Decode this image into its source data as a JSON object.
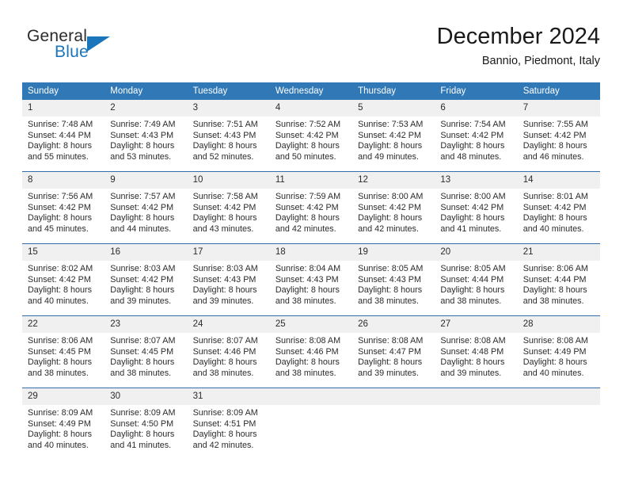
{
  "brand": {
    "name_part1": "General",
    "name_part2": "Blue",
    "logo_icon": "triangle-logo-icon",
    "accent_color": "#1b75bb"
  },
  "header": {
    "month_title": "December 2024",
    "location": "Bannio, Piedmont, Italy"
  },
  "calendar": {
    "header_bg_color": "#3178b6",
    "daynum_bg_color": "#f0f0f0",
    "weekdays": [
      "Sunday",
      "Monday",
      "Tuesday",
      "Wednesday",
      "Thursday",
      "Friday",
      "Saturday"
    ],
    "weeks": [
      [
        {
          "day": "1",
          "sunrise": "Sunrise: 7:48 AM",
          "sunset": "Sunset: 4:44 PM",
          "daylight_line1": "Daylight: 8 hours",
          "daylight_line2": "and 55 minutes."
        },
        {
          "day": "2",
          "sunrise": "Sunrise: 7:49 AM",
          "sunset": "Sunset: 4:43 PM",
          "daylight_line1": "Daylight: 8 hours",
          "daylight_line2": "and 53 minutes."
        },
        {
          "day": "3",
          "sunrise": "Sunrise: 7:51 AM",
          "sunset": "Sunset: 4:43 PM",
          "daylight_line1": "Daylight: 8 hours",
          "daylight_line2": "and 52 minutes."
        },
        {
          "day": "4",
          "sunrise": "Sunrise: 7:52 AM",
          "sunset": "Sunset: 4:42 PM",
          "daylight_line1": "Daylight: 8 hours",
          "daylight_line2": "and 50 minutes."
        },
        {
          "day": "5",
          "sunrise": "Sunrise: 7:53 AM",
          "sunset": "Sunset: 4:42 PM",
          "daylight_line1": "Daylight: 8 hours",
          "daylight_line2": "and 49 minutes."
        },
        {
          "day": "6",
          "sunrise": "Sunrise: 7:54 AM",
          "sunset": "Sunset: 4:42 PM",
          "daylight_line1": "Daylight: 8 hours",
          "daylight_line2": "and 48 minutes."
        },
        {
          "day": "7",
          "sunrise": "Sunrise: 7:55 AM",
          "sunset": "Sunset: 4:42 PM",
          "daylight_line1": "Daylight: 8 hours",
          "daylight_line2": "and 46 minutes."
        }
      ],
      [
        {
          "day": "8",
          "sunrise": "Sunrise: 7:56 AM",
          "sunset": "Sunset: 4:42 PM",
          "daylight_line1": "Daylight: 8 hours",
          "daylight_line2": "and 45 minutes."
        },
        {
          "day": "9",
          "sunrise": "Sunrise: 7:57 AM",
          "sunset": "Sunset: 4:42 PM",
          "daylight_line1": "Daylight: 8 hours",
          "daylight_line2": "and 44 minutes."
        },
        {
          "day": "10",
          "sunrise": "Sunrise: 7:58 AM",
          "sunset": "Sunset: 4:42 PM",
          "daylight_line1": "Daylight: 8 hours",
          "daylight_line2": "and 43 minutes."
        },
        {
          "day": "11",
          "sunrise": "Sunrise: 7:59 AM",
          "sunset": "Sunset: 4:42 PM",
          "daylight_line1": "Daylight: 8 hours",
          "daylight_line2": "and 42 minutes."
        },
        {
          "day": "12",
          "sunrise": "Sunrise: 8:00 AM",
          "sunset": "Sunset: 4:42 PM",
          "daylight_line1": "Daylight: 8 hours",
          "daylight_line2": "and 42 minutes."
        },
        {
          "day": "13",
          "sunrise": "Sunrise: 8:00 AM",
          "sunset": "Sunset: 4:42 PM",
          "daylight_line1": "Daylight: 8 hours",
          "daylight_line2": "and 41 minutes."
        },
        {
          "day": "14",
          "sunrise": "Sunrise: 8:01 AM",
          "sunset": "Sunset: 4:42 PM",
          "daylight_line1": "Daylight: 8 hours",
          "daylight_line2": "and 40 minutes."
        }
      ],
      [
        {
          "day": "15",
          "sunrise": "Sunrise: 8:02 AM",
          "sunset": "Sunset: 4:42 PM",
          "daylight_line1": "Daylight: 8 hours",
          "daylight_line2": "and 40 minutes."
        },
        {
          "day": "16",
          "sunrise": "Sunrise: 8:03 AM",
          "sunset": "Sunset: 4:42 PM",
          "daylight_line1": "Daylight: 8 hours",
          "daylight_line2": "and 39 minutes."
        },
        {
          "day": "17",
          "sunrise": "Sunrise: 8:03 AM",
          "sunset": "Sunset: 4:43 PM",
          "daylight_line1": "Daylight: 8 hours",
          "daylight_line2": "and 39 minutes."
        },
        {
          "day": "18",
          "sunrise": "Sunrise: 8:04 AM",
          "sunset": "Sunset: 4:43 PM",
          "daylight_line1": "Daylight: 8 hours",
          "daylight_line2": "and 38 minutes."
        },
        {
          "day": "19",
          "sunrise": "Sunrise: 8:05 AM",
          "sunset": "Sunset: 4:43 PM",
          "daylight_line1": "Daylight: 8 hours",
          "daylight_line2": "and 38 minutes."
        },
        {
          "day": "20",
          "sunrise": "Sunrise: 8:05 AM",
          "sunset": "Sunset: 4:44 PM",
          "daylight_line1": "Daylight: 8 hours",
          "daylight_line2": "and 38 minutes."
        },
        {
          "day": "21",
          "sunrise": "Sunrise: 8:06 AM",
          "sunset": "Sunset: 4:44 PM",
          "daylight_line1": "Daylight: 8 hours",
          "daylight_line2": "and 38 minutes."
        }
      ],
      [
        {
          "day": "22",
          "sunrise": "Sunrise: 8:06 AM",
          "sunset": "Sunset: 4:45 PM",
          "daylight_line1": "Daylight: 8 hours",
          "daylight_line2": "and 38 minutes."
        },
        {
          "day": "23",
          "sunrise": "Sunrise: 8:07 AM",
          "sunset": "Sunset: 4:45 PM",
          "daylight_line1": "Daylight: 8 hours",
          "daylight_line2": "and 38 minutes."
        },
        {
          "day": "24",
          "sunrise": "Sunrise: 8:07 AM",
          "sunset": "Sunset: 4:46 PM",
          "daylight_line1": "Daylight: 8 hours",
          "daylight_line2": "and 38 minutes."
        },
        {
          "day": "25",
          "sunrise": "Sunrise: 8:08 AM",
          "sunset": "Sunset: 4:46 PM",
          "daylight_line1": "Daylight: 8 hours",
          "daylight_line2": "and 38 minutes."
        },
        {
          "day": "26",
          "sunrise": "Sunrise: 8:08 AM",
          "sunset": "Sunset: 4:47 PM",
          "daylight_line1": "Daylight: 8 hours",
          "daylight_line2": "and 39 minutes."
        },
        {
          "day": "27",
          "sunrise": "Sunrise: 8:08 AM",
          "sunset": "Sunset: 4:48 PM",
          "daylight_line1": "Daylight: 8 hours",
          "daylight_line2": "and 39 minutes."
        },
        {
          "day": "28",
          "sunrise": "Sunrise: 8:08 AM",
          "sunset": "Sunset: 4:49 PM",
          "daylight_line1": "Daylight: 8 hours",
          "daylight_line2": "and 40 minutes."
        }
      ],
      [
        {
          "day": "29",
          "sunrise": "Sunrise: 8:09 AM",
          "sunset": "Sunset: 4:49 PM",
          "daylight_line1": "Daylight: 8 hours",
          "daylight_line2": "and 40 minutes."
        },
        {
          "day": "30",
          "sunrise": "Sunrise: 8:09 AM",
          "sunset": "Sunset: 4:50 PM",
          "daylight_line1": "Daylight: 8 hours",
          "daylight_line2": "and 41 minutes."
        },
        {
          "day": "31",
          "sunrise": "Sunrise: 8:09 AM",
          "sunset": "Sunset: 4:51 PM",
          "daylight_line1": "Daylight: 8 hours",
          "daylight_line2": "and 42 minutes."
        },
        {
          "day": "",
          "sunrise": "",
          "sunset": "",
          "daylight_line1": "",
          "daylight_line2": ""
        },
        {
          "day": "",
          "sunrise": "",
          "sunset": "",
          "daylight_line1": "",
          "daylight_line2": ""
        },
        {
          "day": "",
          "sunrise": "",
          "sunset": "",
          "daylight_line1": "",
          "daylight_line2": ""
        },
        {
          "day": "",
          "sunrise": "",
          "sunset": "",
          "daylight_line1": "",
          "daylight_line2": ""
        }
      ]
    ]
  }
}
